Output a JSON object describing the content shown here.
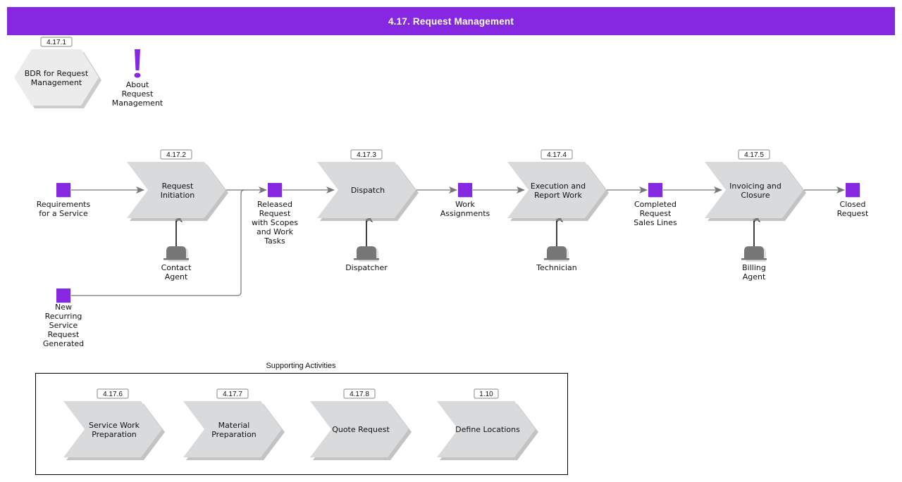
{
  "header": {
    "title": "4.17. Request Management"
  },
  "colors": {
    "accent": "#8627e2",
    "process_fill": "#d9dadc",
    "process_shadow": "#a9a9a9",
    "role_fill": "#777777",
    "connector": "#777777"
  },
  "overview": {
    "bdr": {
      "tag": "4.17.1",
      "label": [
        "BDR for Request",
        "Management"
      ]
    },
    "about": {
      "icon": "exclamation-icon",
      "label": [
        "About",
        "Request",
        "Management"
      ]
    }
  },
  "main_flow": {
    "processes": [
      {
        "tag": "4.17.2",
        "label": [
          "Request",
          "Initiation"
        ],
        "role": [
          "Contact",
          "Agent"
        ]
      },
      {
        "tag": "4.17.3",
        "label": [
          "Dispatch"
        ],
        "role": [
          "Dispatcher"
        ]
      },
      {
        "tag": "4.17.4",
        "label": [
          "Execution and",
          "Report Work"
        ],
        "role": [
          "Technician"
        ]
      },
      {
        "tag": "4.17.5",
        "label": [
          "Invoicing and",
          "Closure"
        ],
        "role": [
          "Billing",
          "Agent"
        ]
      }
    ],
    "events": [
      {
        "label": [
          "Requirements",
          "for a Service"
        ]
      },
      {
        "label": [
          "Released",
          "Request",
          "with Scopes",
          "and Work",
          "Tasks"
        ]
      },
      {
        "label": [
          "Work",
          "Assignments"
        ]
      },
      {
        "label": [
          "Completed",
          "Request",
          "Sales Lines"
        ]
      },
      {
        "label": [
          "Closed",
          "Request"
        ]
      },
      {
        "label": [
          "New",
          "Recurring",
          "Service",
          "Request",
          "Generated"
        ]
      }
    ]
  },
  "supporting": {
    "title": "Supporting Activities",
    "processes": [
      {
        "tag": "4.17.6",
        "label": [
          "Service Work",
          "Preparation"
        ]
      },
      {
        "tag": "4.17.7",
        "label": [
          "Material",
          "Preparation"
        ]
      },
      {
        "tag": "4.17.8",
        "label": [
          "Quote Request"
        ]
      },
      {
        "tag": "1.10",
        "label": [
          "Define Locations"
        ]
      }
    ]
  }
}
